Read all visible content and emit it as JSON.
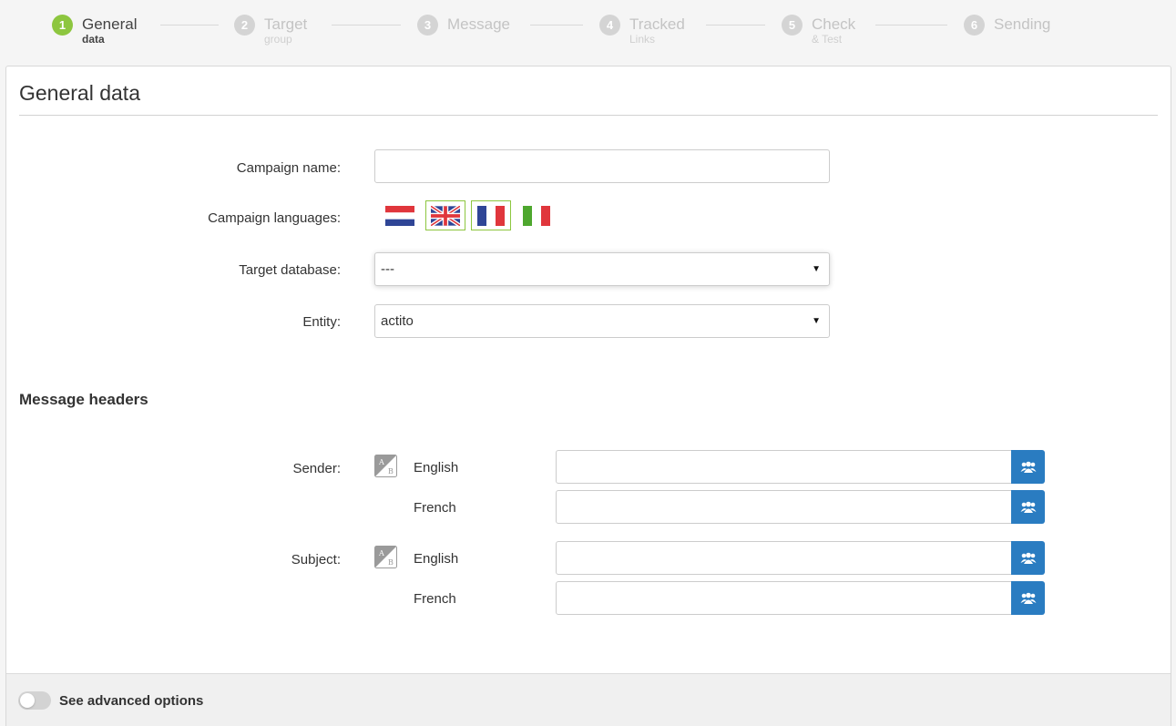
{
  "steps": [
    {
      "num": "1",
      "title": "General",
      "sub": "data"
    },
    {
      "num": "2",
      "title": "Target",
      "sub": "group"
    },
    {
      "num": "3",
      "title": "Message",
      "sub": ""
    },
    {
      "num": "4",
      "title": "Tracked",
      "sub": "Links"
    },
    {
      "num": "5",
      "title": "Check",
      "sub": "& Test"
    },
    {
      "num": "6",
      "title": "Sending",
      "sub": ""
    }
  ],
  "active_step": 1,
  "colors": {
    "accent": "#8dc63f",
    "button": "#2a7cc1",
    "inactive_step": "#d4d4d4"
  },
  "page": {
    "title": "General data"
  },
  "form": {
    "campaign_name_label": "Campaign name:",
    "campaign_name_value": "",
    "languages_label": "Campaign languages:",
    "languages": [
      {
        "code": "nl",
        "selected": false,
        "icon": "flag-nl-icon"
      },
      {
        "code": "en",
        "selected": true,
        "icon": "flag-gb-icon"
      },
      {
        "code": "fr",
        "selected": true,
        "icon": "flag-fr-icon"
      },
      {
        "code": "it",
        "selected": false,
        "icon": "flag-it-icon"
      }
    ],
    "target_db_label": "Target database:",
    "target_db_value": "---",
    "entity_label": "Entity:",
    "entity_value": "actito"
  },
  "headers": {
    "title": "Message headers",
    "sender_label": "Sender:",
    "subject_label": "Subject:",
    "lang_english": "English",
    "lang_french": "French"
  },
  "footer": {
    "advanced_label": "See advanced options",
    "advanced_on": false
  }
}
